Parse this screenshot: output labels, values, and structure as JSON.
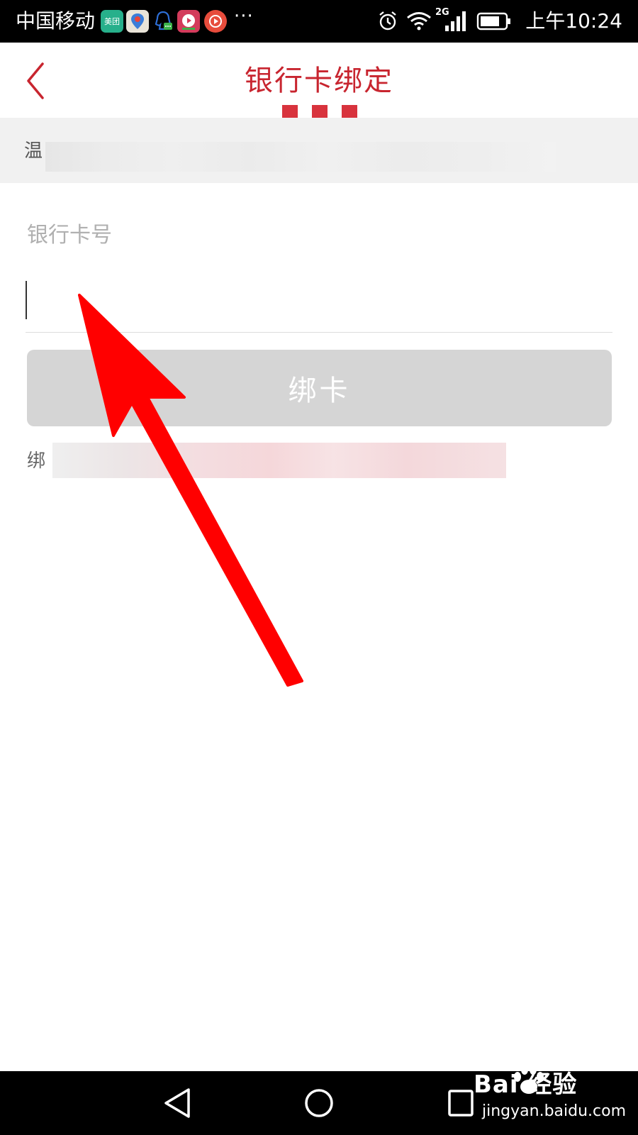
{
  "status_bar": {
    "carrier": "中国移动",
    "notification_icons": [
      "meituan-icon",
      "baidu-map-icon",
      "qq-icon",
      "video-icon",
      "play-icon"
    ],
    "meituan_label": "美团",
    "overflow": "···",
    "network": "2G",
    "time": "上午10:24"
  },
  "header": {
    "title": "银行卡绑定",
    "accent_color": "#c8252f"
  },
  "tip": {
    "prefix": "温"
  },
  "form": {
    "card_label": "银行卡号",
    "card_value": "",
    "bind_button": "绑卡",
    "button_color": "#d5d5d5",
    "note_prefix": "绑"
  },
  "annotation": {
    "color": "#ff0000"
  },
  "nav_bar": {
    "buttons": [
      "back-icon",
      "home-icon",
      "recents-icon"
    ]
  },
  "watermark": {
    "brand": "Bai  经验",
    "url": "jingyan.baidu.com"
  }
}
